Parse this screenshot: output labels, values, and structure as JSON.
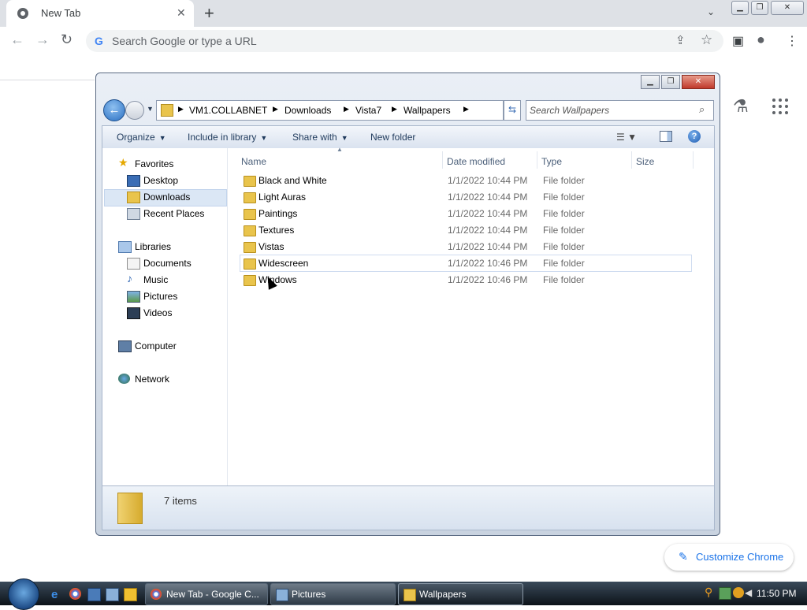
{
  "browser": {
    "tab_title": "New Tab",
    "omnibox_placeholder": "Search Google or type a URL",
    "customize_label": "Customize Chrome"
  },
  "explorer": {
    "breadcrumb": [
      "VM1.COLLABNET",
      "Downloads",
      "Vista7",
      "Wallpapers"
    ],
    "search_placeholder": "Search Wallpapers",
    "commands": {
      "organize": "Organize",
      "include": "Include in library",
      "share": "Share with",
      "newfolder": "New folder"
    },
    "nav": {
      "favorites": "Favorites",
      "desktop": "Desktop",
      "downloads": "Downloads",
      "recent": "Recent Places",
      "libraries": "Libraries",
      "documents": "Documents",
      "music": "Music",
      "pictures": "Pictures",
      "videos": "Videos",
      "computer": "Computer",
      "network": "Network"
    },
    "columns": {
      "name": "Name",
      "date": "Date modified",
      "type": "Type",
      "size": "Size"
    },
    "files": [
      {
        "name": "Black and White",
        "date": "1/1/2022 10:44 PM",
        "type": "File folder"
      },
      {
        "name": "Light Auras",
        "date": "1/1/2022 10:44 PM",
        "type": "File folder"
      },
      {
        "name": "Paintings",
        "date": "1/1/2022 10:44 PM",
        "type": "File folder"
      },
      {
        "name": "Textures",
        "date": "1/1/2022 10:44 PM",
        "type": "File folder"
      },
      {
        "name": "Vistas",
        "date": "1/1/2022 10:44 PM",
        "type": "File folder"
      },
      {
        "name": "Widescreen",
        "date": "1/1/2022 10:46 PM",
        "type": "File folder"
      },
      {
        "name": "Windows",
        "date": "1/1/2022 10:46 PM",
        "type": "File folder"
      }
    ],
    "item_count": "7 items"
  },
  "taskbar": {
    "buttons": [
      {
        "label": "New Tab - Google C...",
        "icon": "chrome-icon"
      },
      {
        "label": "Pictures",
        "icon": "explorer-icon"
      },
      {
        "label": "Wallpapers",
        "icon": "folder-icon"
      }
    ],
    "clock": "11:50 PM"
  },
  "colors": {
    "chrome_blue": "#1a73e8",
    "folder_yellow": "#e9c44c",
    "selection": "#dbe7f5"
  }
}
